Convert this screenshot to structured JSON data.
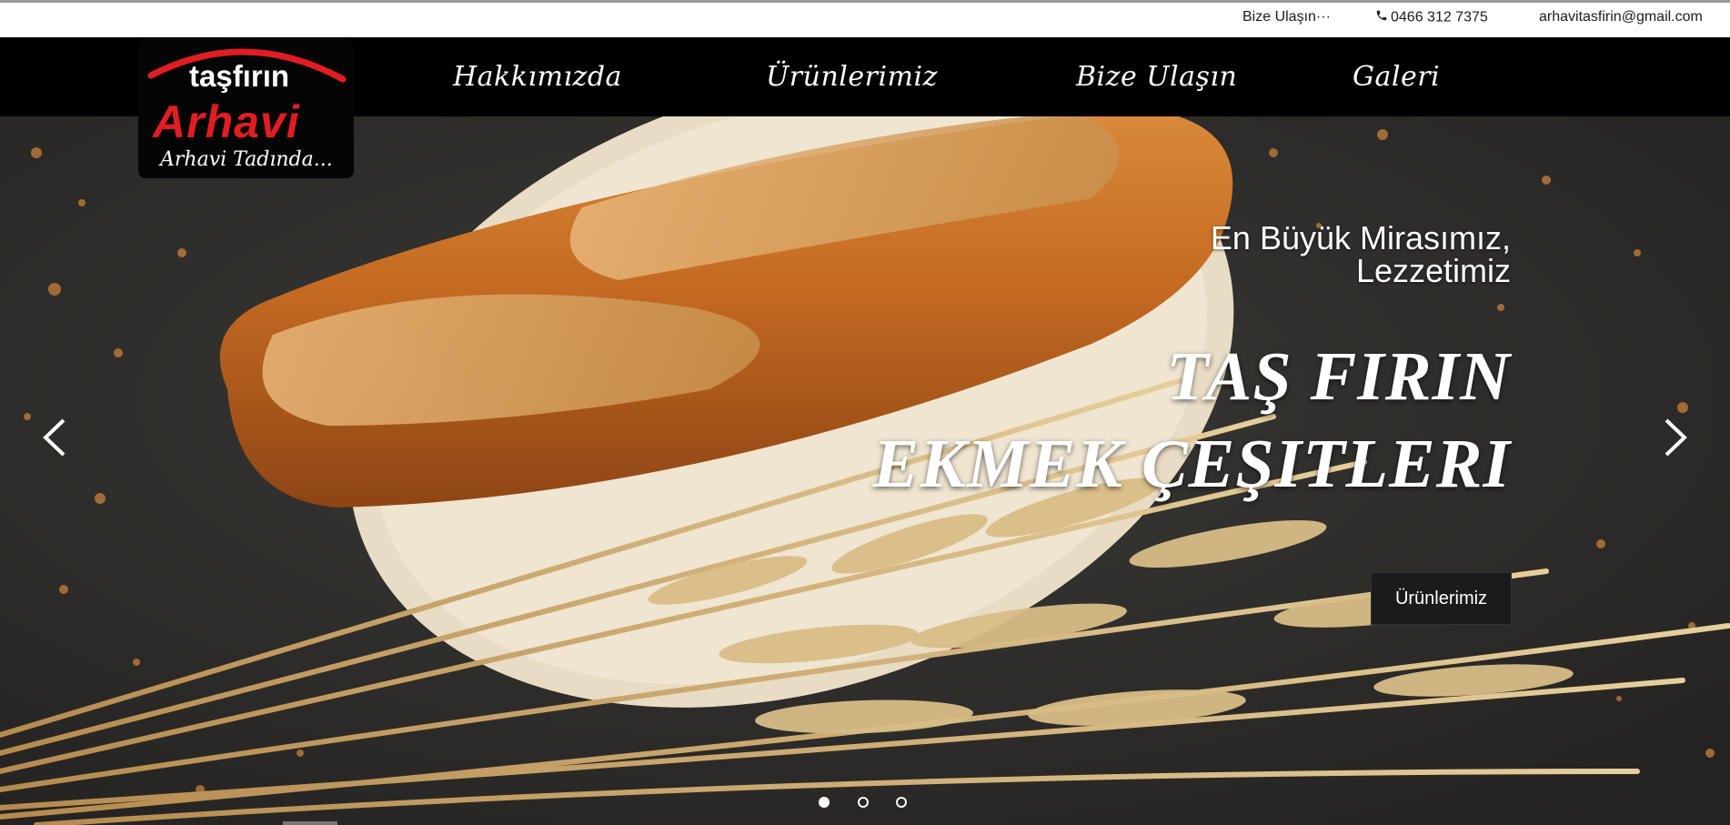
{
  "topbar": {
    "contact_link": "Bize Ulaşın···",
    "phone": "0466 312 7375",
    "email": "arhavitasfirin@gmail.com"
  },
  "logo": {
    "top_text": "taşfırın",
    "main_text": "Arhavi",
    "tagline": "Arhavi Tadında..."
  },
  "nav": {
    "items": [
      {
        "label": "Hakkımızda"
      },
      {
        "label": "Ürünlerimiz"
      },
      {
        "label": "Bize  Ulaşın"
      },
      {
        "label": "Galeri"
      }
    ]
  },
  "hero": {
    "subtitle_line1": "En Büyük Mirasımız,",
    "subtitle_line2": "Lezzetimiz",
    "title_line1": "TAŞ FIRIN",
    "title_line2": "EKMEK ÇEŞITLERI",
    "button_label": "Ürünlerimiz",
    "slide_count": 3,
    "active_slide": 1
  },
  "icons": {
    "phone": "phone-icon",
    "prev": "chevron-left-icon",
    "next": "chevron-right-icon"
  },
  "colors": {
    "brand_red": "#e11d24",
    "nav_bg": "#000000",
    "button_bg": "#1b1b1b"
  }
}
